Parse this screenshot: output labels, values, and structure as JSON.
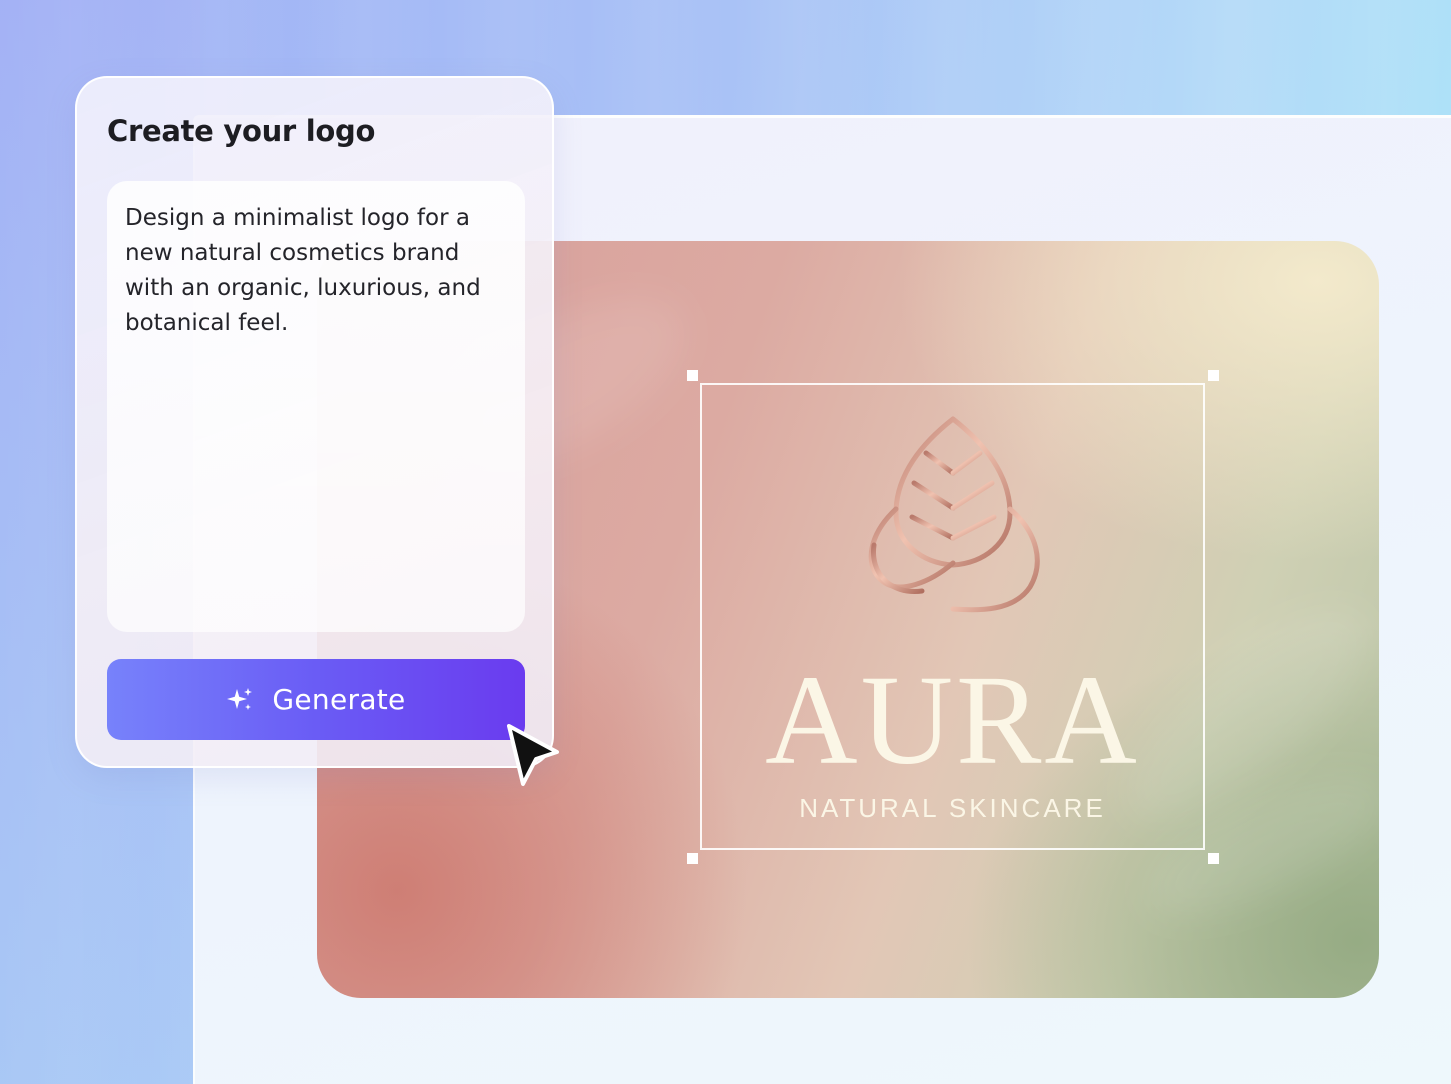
{
  "prompt_panel": {
    "title": "Create your logo",
    "prompt_text": "Design a minimalist logo for a new natural cosmetics brand with an organic, luxurious, and botanical feel.",
    "generate_label": "Generate",
    "generate_icon": "sparkle-icon",
    "button_color": "#6a5cf5"
  },
  "canvas": {
    "logo": {
      "wordmark": "AURA",
      "tagline": "NATURAL SKINCARE",
      "mark_icon": "leaf-icon",
      "mark_color": "#c48a7a",
      "text_color": "#fbf6e6"
    }
  },
  "pointer": {
    "icon": "cursor-arrow-icon"
  }
}
